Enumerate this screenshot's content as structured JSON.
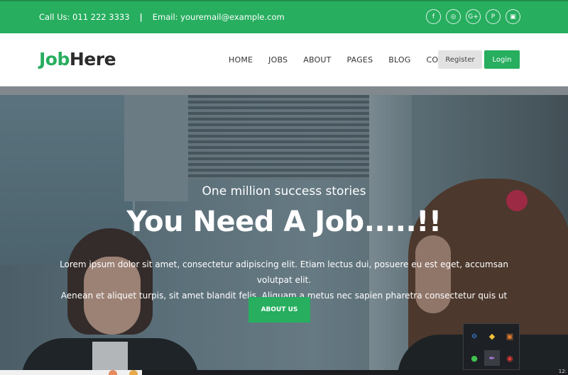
{
  "topbar": {
    "phone": "Call Us: 011 222 3333",
    "separator": "|",
    "email": "Email: youremail@example.com",
    "socials": [
      {
        "icon": "facebook-icon",
        "glyph": "f"
      },
      {
        "icon": "rss-icon",
        "glyph": "ॐ"
      },
      {
        "icon": "google-plus-icon",
        "glyph": "G+"
      },
      {
        "icon": "pinterest-icon",
        "glyph": "P"
      },
      {
        "icon": "instagram-icon",
        "glyph": "▣"
      }
    ]
  },
  "nav": {
    "logo_part1": "Job",
    "logo_part2": "Here",
    "items": [
      "HOME",
      "JOBS",
      "ABOUT",
      "PAGES",
      "BLOG",
      "CONTACT"
    ],
    "register_label": "Register",
    "login_label": "Login"
  },
  "hero": {
    "subtitle": "One million success stories",
    "title": "You Need A Job.....!!",
    "text_line1": "Lorem ipsum dolor sit amet, consectetur adipiscing elit. Etiam lectus dui, posuere eu est eget, accumsan volutpat elit.",
    "text_line2": "Aenean et aliquet turpis, sit amet blandit felis. Aliquam a metus nec sapien pharetra consectetur quis ut",
    "button_label": "ABOUT US"
  },
  "tray": {
    "icons": [
      "bluetooth-icon",
      "security-icon",
      "app-icon",
      "whatsapp-icon",
      "pen-icon",
      "record-icon"
    ]
  },
  "taskbar": {
    "time": "12:"
  },
  "colors": {
    "accent": "#27ae5f",
    "register_bg": "#e2e2e2"
  }
}
